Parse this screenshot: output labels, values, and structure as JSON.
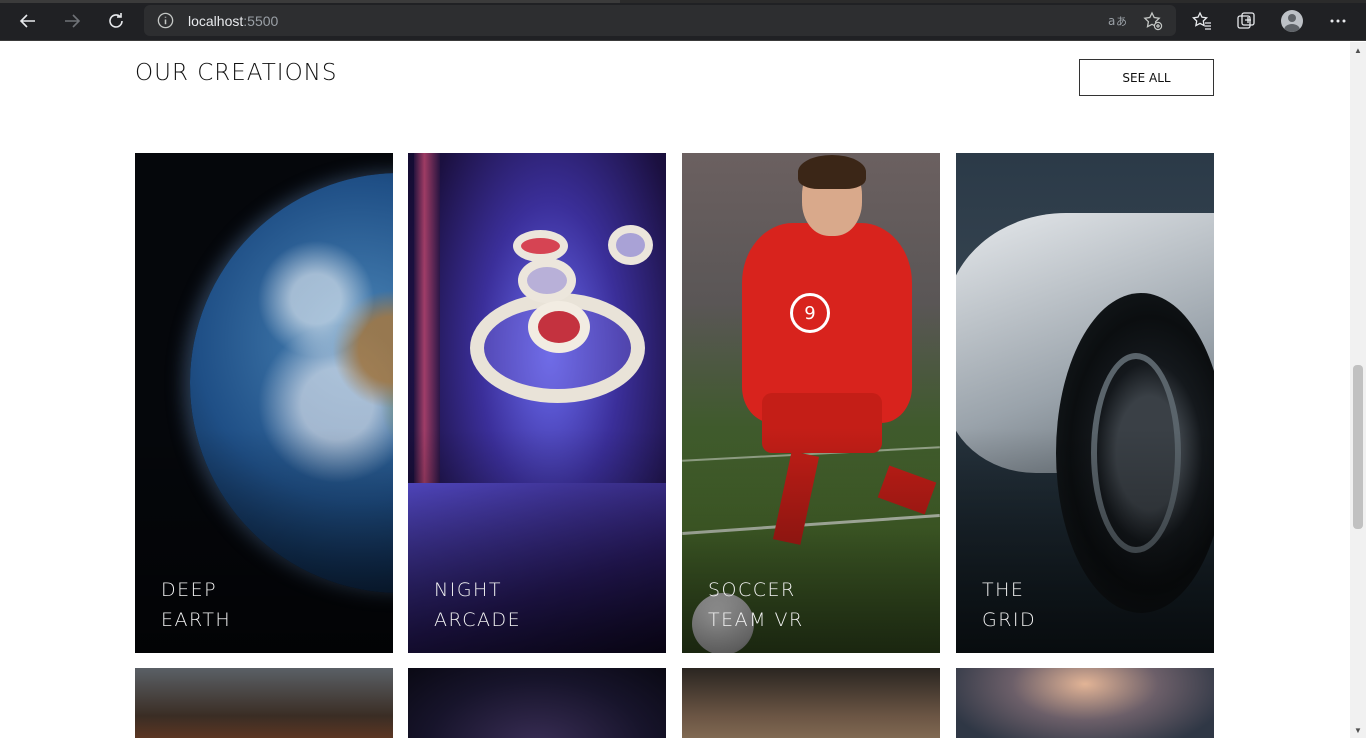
{
  "browser": {
    "url_host": "localhost",
    "url_port": ":5500",
    "icons": [
      "back-arrow-icon",
      "forward-arrow-icon",
      "refresh-icon",
      "info-icon",
      "read-aloud-icon",
      "add-favorite-icon",
      "favorites-icon",
      "collections-icon",
      "profile-avatar-icon",
      "more-menu-icon"
    ]
  },
  "section": {
    "title": "OUR CREATIONS",
    "see_all_label": "SEE ALL"
  },
  "creations": [
    {
      "line1": "DEEP",
      "line2": "EARTH"
    },
    {
      "line1": "NIGHT",
      "line2": "ARCADE"
    },
    {
      "line1": "SOCCER",
      "line2": "TEAM VR"
    },
    {
      "line1": "THE",
      "line2": "GRID"
    }
  ],
  "colors": {
    "chrome_bg": "#202124",
    "page_bg": "#ffffff",
    "text": "#111111",
    "card_label": "#f2f2f2"
  }
}
